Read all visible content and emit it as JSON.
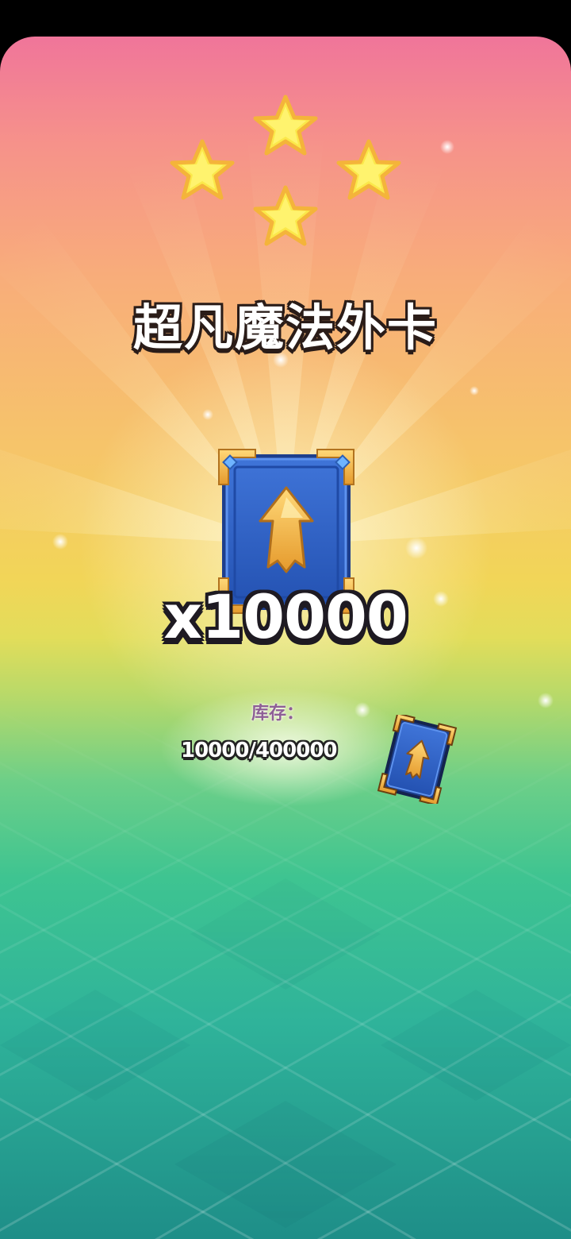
{
  "reward": {
    "title": "超凡魔法外卡",
    "rarity_stars": 4,
    "quantity": "x10000",
    "item_icon": "magic-wild-card-icon"
  },
  "inventory": {
    "label": "库存：",
    "value": "10000/400000",
    "icon": "magic-wild-card-small-icon"
  },
  "colors": {
    "sky_top": "#f0759a",
    "sky_mid": "#f6c46a",
    "horizon": "#e2dd5a",
    "floor": "#2fb39a",
    "card_blue": "#2f5fc4",
    "card_gold": "#f2b64a",
    "star_yellow": "#fbe84a"
  }
}
